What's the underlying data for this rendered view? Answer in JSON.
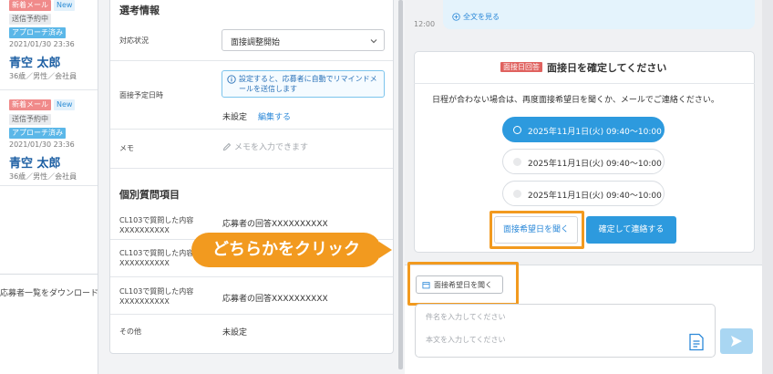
{
  "candidates": [
    {
      "badge_new_mail": "新着メール",
      "badge_new": "New",
      "status": "送信予約中",
      "approach": "アプローチ済み",
      "date": "2021/01/30 23:36",
      "name": "青空 太郎",
      "meta": "36歳／男性／会社員"
    },
    {
      "badge_new_mail": "新着メール",
      "badge_new": "New",
      "status": "送信予約中",
      "approach": "アプローチ済み",
      "date": "2021/01/30 23:36",
      "name": "青空 太郎",
      "meta": "36歳／男性／会社員"
    }
  ],
  "download_link": "応募者一覧をダウンロード",
  "selection": {
    "title": "選考情報",
    "status_label": "対応状況",
    "status_value": "面接調整開始",
    "date_label": "面接予定日時",
    "info_text": "設定すると、応募者に自動でリマインドメールを送信します",
    "date_value": "未設定",
    "edit_link": "編集する",
    "memo_label": "メモ",
    "memo_placeholder": "メモを入力できます"
  },
  "questions": {
    "title": "個別質問項目",
    "items": [
      {
        "label": "CL103で質問した内容XXXXXXXXXX",
        "answer": "応募者の回答XXXXXXXXXX"
      },
      {
        "label": "CL103で質問した内容XXXXXXXXXX",
        "answer": ""
      },
      {
        "label": "CL103で質問した内容XXXXXXXXXX",
        "answer": "応募者の回答XXXXXXXXXX"
      }
    ],
    "other_label": "その他",
    "other_value": "未設定"
  },
  "annotation": {
    "bubble_text": "どちらかをクリック",
    "accent_color": "#f29a1f"
  },
  "chat": {
    "dash_line": "------------------------------",
    "expand_label": "全文を見る",
    "time": "12:00",
    "card": {
      "tag": "面接日回答",
      "title": "面接日を確定してください",
      "description": "日程が合わない場合は、再度面接希望日を聞くか、メールでご連絡ください。",
      "slots": [
        "2025年11月1日(火) 09:40〜10:00",
        "2025年11月1日(火) 09:40〜10:00",
        "2025年11月1日(火) 09:40〜10:00"
      ],
      "selected_slot_index": 0,
      "ask_button": "面接希望日を聞く",
      "confirm_button": "確定して連絡する"
    },
    "composer": {
      "chip_label": "面接希望日を聞く",
      "subject_placeholder": "件名を入力してください",
      "body_placeholder": "本文を入力してください"
    }
  },
  "colors": {
    "primary": "#2d9ade",
    "link": "#2b88d8",
    "name": "#1d5fa3",
    "tag_red": "#e0625f"
  }
}
